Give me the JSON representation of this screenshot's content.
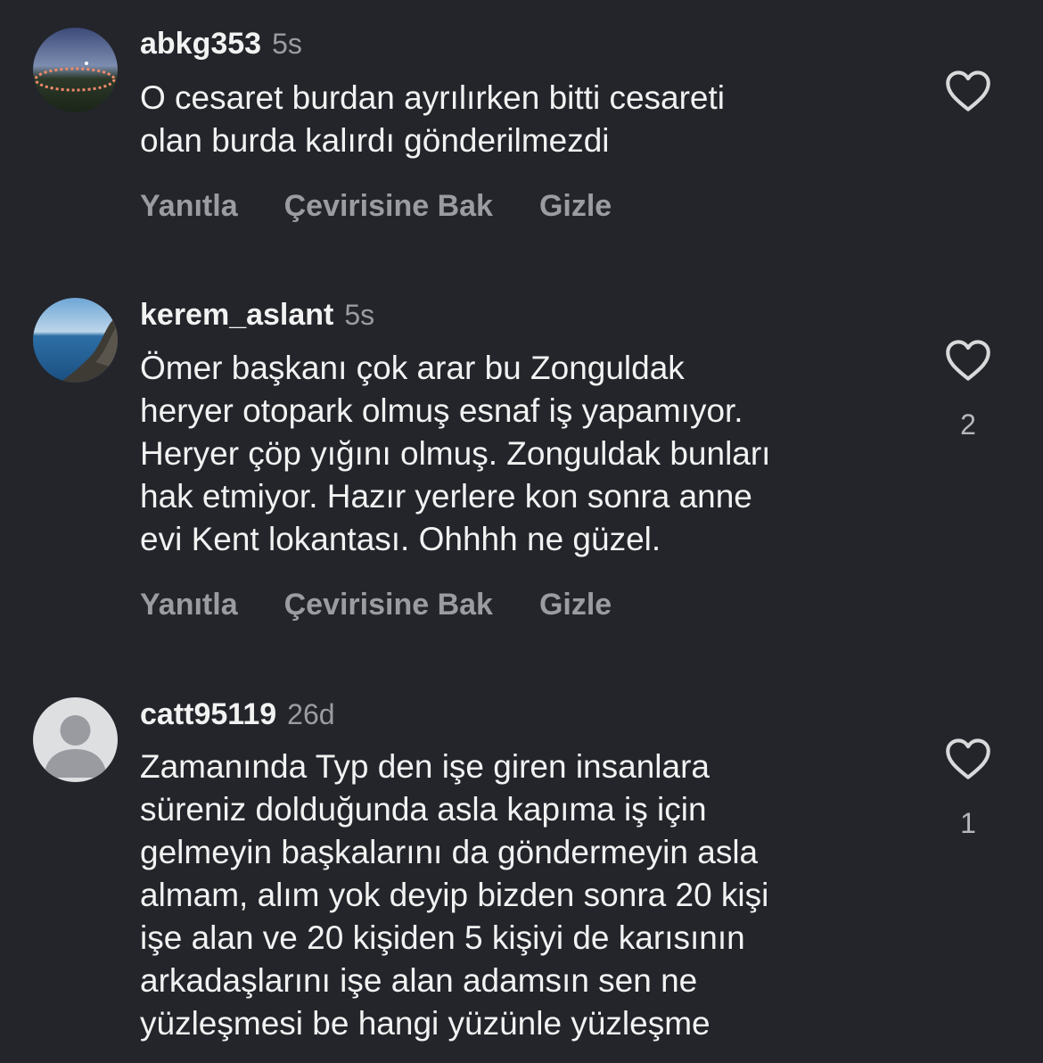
{
  "comments": [
    {
      "username": "abkg353",
      "time": "5s",
      "lines": [
        "O cesaret burdan ayrılırken bitti cesareti",
        "olan burda kalırdı gönderilmezdi"
      ],
      "actions": {
        "reply": "Yanıtla",
        "translate": "Çevirisine Bak",
        "hide": "Gizle"
      },
      "like_icon": "heart-outline-icon",
      "like_count": ""
    },
    {
      "username": "kerem_aslant",
      "time": "5s",
      "lines": [
        "Ömer başkanı çok arar bu Zonguldak",
        "heryer otopark olmuş esnaf iş yapamıyor.",
        "Heryer çöp yığını olmuş. Zonguldak bunları",
        "hak etmiyor. Hazır yerlere kon sonra anne",
        "evi Kent lokantası. Ohhhh ne güzel."
      ],
      "actions": {
        "reply": "Yanıtla",
        "translate": "Çevirisine Bak",
        "hide": "Gizle"
      },
      "like_icon": "heart-outline-icon",
      "like_count": "2"
    },
    {
      "username": "catt95119",
      "time": "26d",
      "lines": [
        "Zamanında Typ den işe giren insanlara",
        "süreniz dolduğunda asla kapıma iş için",
        "gelmeyin başkalarını da göndermeyin asla",
        "almam, alım yok deyip bizden sonra 20 kişi",
        "işe alan ve 20 kişiden 5 kişiyi de karısının",
        "arkadaşlarını işe alan adamsın sen ne",
        "yüzleşmesi be hangi yüzünle yüzleşme"
      ],
      "actions": null,
      "like_icon": "heart-outline-icon",
      "like_count": "1"
    }
  ],
  "colors": {
    "background": "#23252b",
    "primary_text": "#f2f2f2",
    "secondary_text": "#9a9ca2"
  }
}
